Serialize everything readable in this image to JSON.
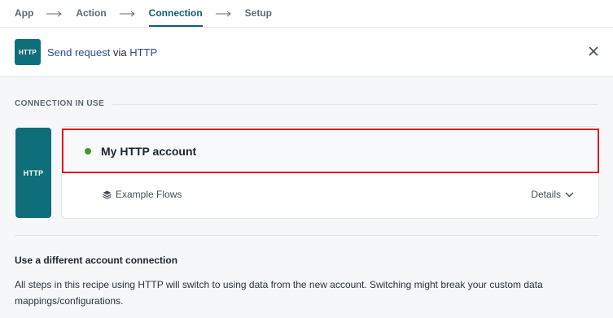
{
  "breadcrumb": {
    "steps": [
      {
        "label": "App",
        "active": false
      },
      {
        "label": "Action",
        "active": false
      },
      {
        "label": "Connection",
        "active": true
      },
      {
        "label": "Setup",
        "active": false
      }
    ]
  },
  "header": {
    "logo_text": "HTTP",
    "action_link": "Send request",
    "via_text": "via",
    "app_link": "HTTP",
    "close_icon": "close-icon"
  },
  "connection": {
    "section_label": "CONNECTION IN USE",
    "logo_text": "HTTP",
    "account_name": "My HTTP account",
    "status_color": "#3e9a2e",
    "flows_label": "Example Flows",
    "flows_icon": "layers-icon",
    "details_label": "Details",
    "details_icon": "chevron-down-icon"
  },
  "alternate": {
    "title": "Use a different account connection",
    "description": "All steps in this recipe using HTTP will switch to using data from the new account. Switching might break your custom data mappings/configurations."
  },
  "colors": {
    "brand_teal": "#0e6e7a",
    "highlight_red": "#e11b22",
    "link_blue": "#2d4a8a"
  }
}
